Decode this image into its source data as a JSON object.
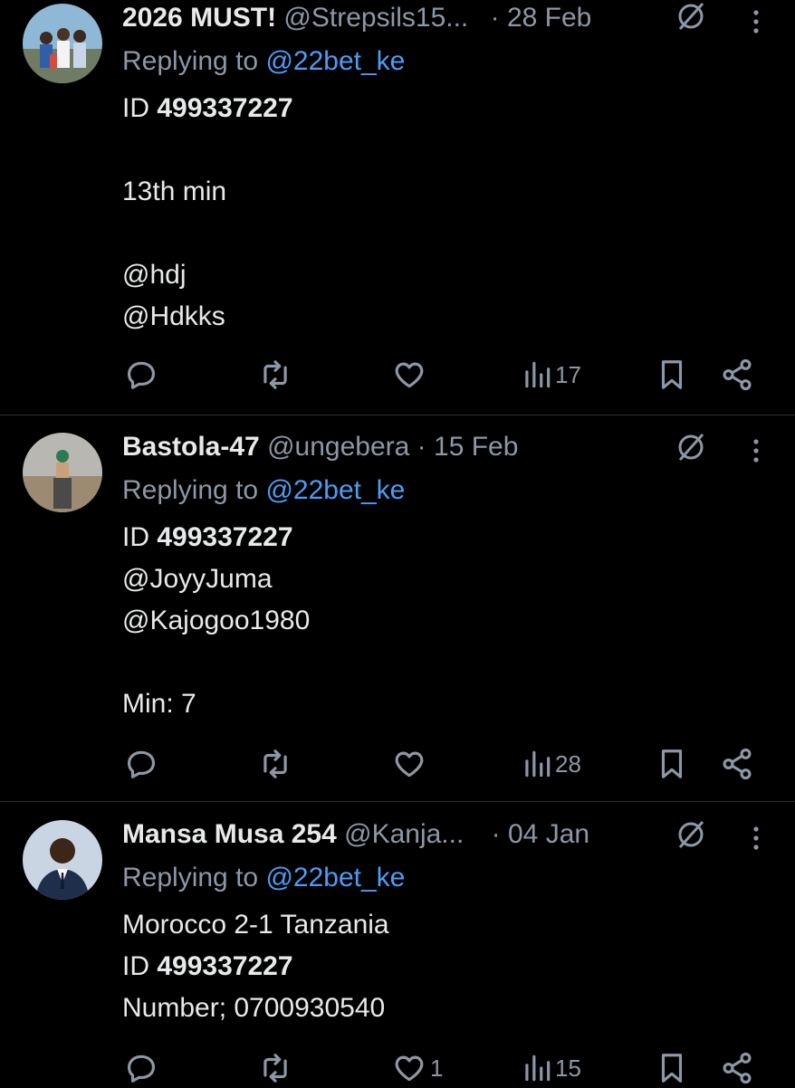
{
  "tweets": [
    {
      "name": "2026 MUST!",
      "handle": "@Strepsils15...",
      "dot": "·",
      "date": "28 Feb",
      "replying_prefix": "Replying to ",
      "replying_to": "@22bet_ke",
      "id_prefix": "ID ",
      "id_value": "499337227",
      "line_minute": "13th min",
      "mention_1": "@hdj",
      "mention_2": "@Hdkks",
      "views": "17",
      "likes": ""
    },
    {
      "name": "Bastola-47",
      "handle": "@ungebera",
      "dot": "·",
      "date": "15 Feb",
      "replying_prefix": "Replying to ",
      "replying_to": "@22bet_ke",
      "id_prefix": "ID ",
      "id_value": "499337227",
      "mention_1": "@JoyyJuma",
      "mention_2": "@Kajogoo1980",
      "line_minute": "Min: 7",
      "views": "28",
      "likes": ""
    },
    {
      "name": "Mansa Musa 254",
      "handle": "@Kanja...",
      "dot": "·",
      "date": "04 Jan",
      "replying_prefix": "Replying to ",
      "replying_to": "@22bet_ke",
      "score_line": "Morocco 2-1 Tanzania",
      "id_prefix": "ID ",
      "id_value": "499337227",
      "number_line": "Number; 0700930540",
      "views": "15",
      "likes": "1"
    }
  ],
  "icons": {
    "reply": "reply-icon",
    "retweet": "retweet-icon",
    "like": "heart-icon",
    "views": "views-icon",
    "bookmark": "bookmark-icon",
    "share": "share-icon",
    "grok": "grok-icon",
    "more": "more-icon"
  },
  "colors": {
    "background": "#000000",
    "text": "#e7e9ea",
    "secondary": "#8b98a5",
    "link": "#4e9cf5"
  }
}
